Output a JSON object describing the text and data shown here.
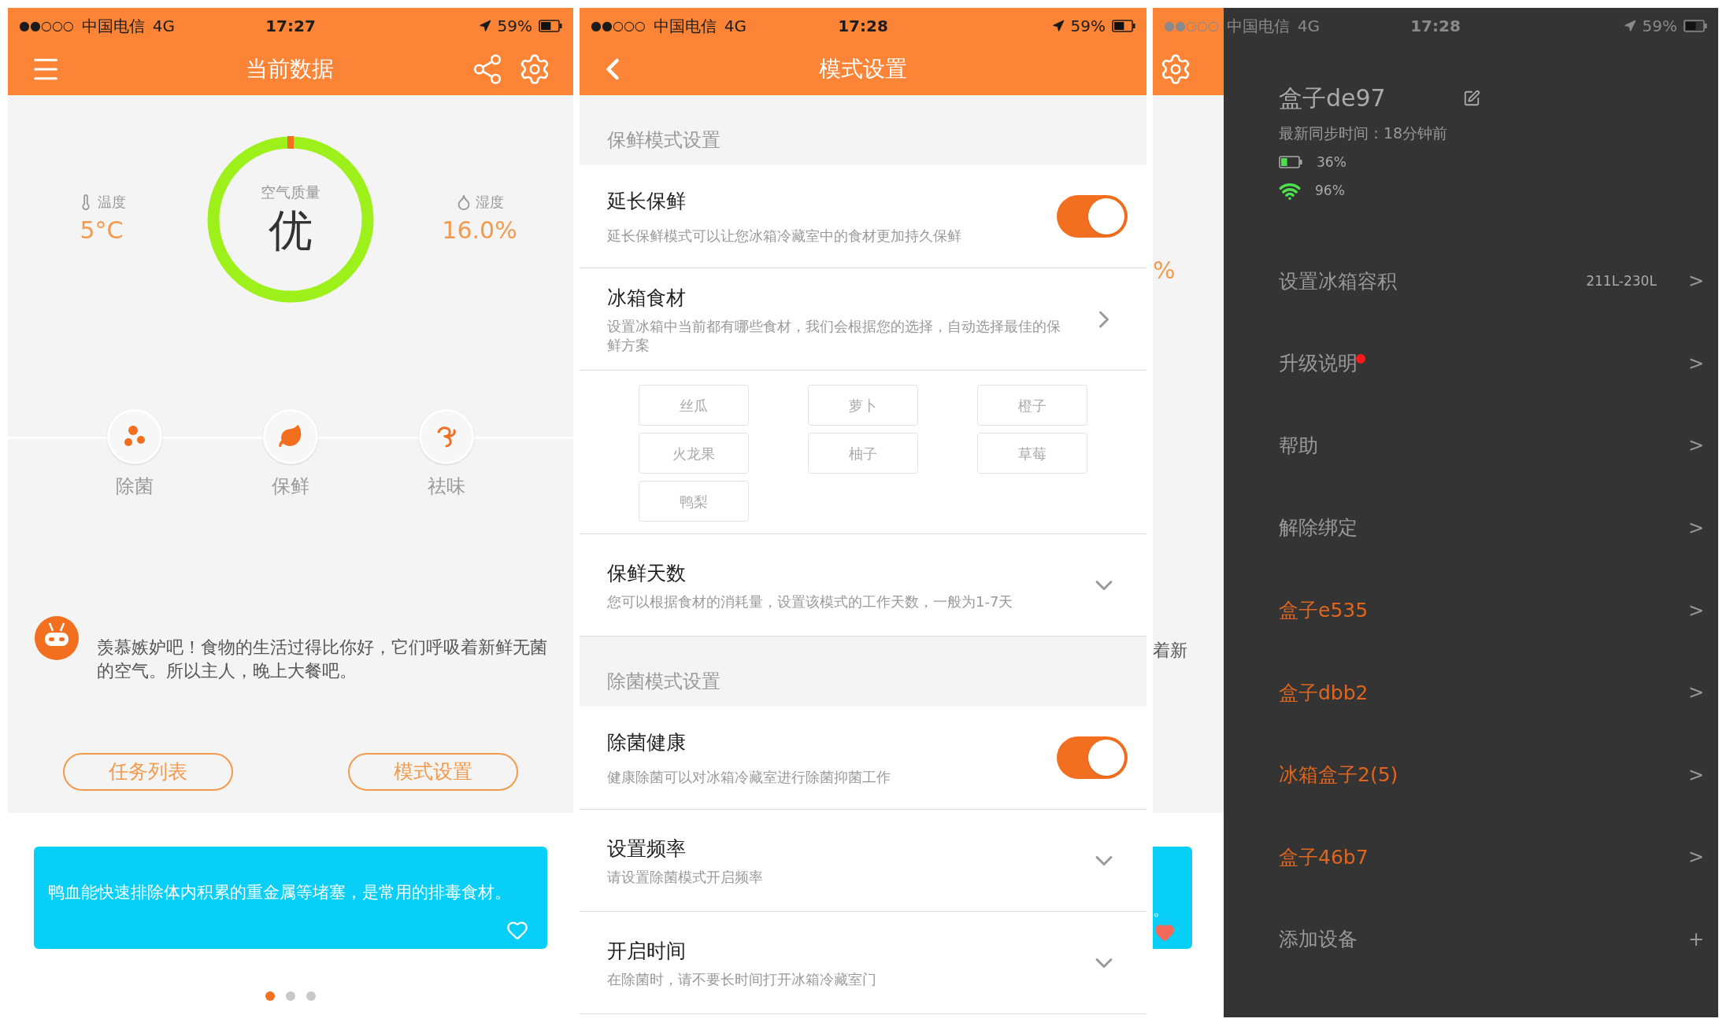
{
  "home_screen": {
    "status_bar": {
      "signal": "●●○○○",
      "carrier": "中国电信",
      "network": "4G",
      "time": "17:27",
      "battery": "59%"
    },
    "title": "当前数据",
    "temperature": {
      "label": "温度",
      "value": "5°C"
    },
    "air_quality": {
      "label": "空气质量",
      "value": "优"
    },
    "humidity": {
      "label": "湿度",
      "value": "16.0%"
    },
    "modes": [
      {
        "kind": "germ",
        "label": "除菌"
      },
      {
        "kind": "leaf",
        "label": "保鲜"
      },
      {
        "kind": "swirl",
        "label": "祛味"
      }
    ],
    "message": "羡慕嫉妒吧！食物的生活过得比你好，它们呼吸着新鲜无菌的空气。所以主人，晚上大餐吧。",
    "buttons": [
      "任务列表",
      "模式设置"
    ],
    "tip": "鸭血能快速排除体内积累的重金属等堵塞，是常用的排毒食材。",
    "page_dots": [
      {
        "selected": true
      },
      {
        "selected": false
      },
      {
        "selected": false
      }
    ]
  },
  "mode_settings_screen": {
    "status_bar": {
      "signal": "●●○○○",
      "carrier": "中国电信",
      "network": "4G",
      "time": "17:28",
      "battery": "59%"
    },
    "title": "模式设置",
    "sections": [
      {
        "header": "保鲜模式设置",
        "rows": [
          {
            "kind": "toggle",
            "title": "延长保鲜",
            "description": "延长保鲜模式可以让您冰箱冷藏室中的食材更加持久保鲜",
            "on": true
          },
          {
            "kind": "link",
            "title": "冰箱食材",
            "description": "设置冰箱中当前都有哪些食材，我们会根据您的选择，自动选择最佳的保鲜方案"
          },
          {
            "kind": "chips",
            "chips": [
              "丝瓜",
              "萝卜",
              "橙子",
              "火龙果",
              "柚子",
              "草莓",
              "鸭梨"
            ]
          },
          {
            "kind": "dropdown",
            "title": "保鲜天数",
            "description": "您可以根据食材的消耗量，设置该模式的工作天数，一般为1-7天"
          }
        ]
      },
      {
        "header": "除菌模式设置",
        "rows": [
          {
            "kind": "toggle",
            "title": "除菌健康",
            "description": "健康除菌可以对冰箱冷藏室进行除菌抑菌工作",
            "on": true
          },
          {
            "kind": "dropdown",
            "title": "设置频率",
            "description": "请设置除菌模式开启频率"
          },
          {
            "kind": "dropdown",
            "title": "开启时间",
            "description": "在除菌时，请不要长时间打开冰箱冷藏室门"
          }
        ]
      }
    ]
  },
  "drawer_screen": {
    "status_bar": {
      "signal": "●●○○○",
      "carrier": "中国电信",
      "network": "4G",
      "time": "17:28",
      "battery": "59%"
    },
    "background_fragments": [
      "%",
      "着新",
      "。"
    ],
    "drawer": {
      "device_name": "盒子de97",
      "sync": "最新同步时间：18分钟前",
      "battery": "36%",
      "wifi": "96%",
      "items": [
        {
          "kind": "setting",
          "label": "设置冰箱容积",
          "value": "211L-230L",
          "new": false,
          "trailing": ">"
        },
        {
          "kind": "setting",
          "label": "升级说明",
          "new": true,
          "trailing": ">"
        },
        {
          "kind": "setting",
          "label": "帮助",
          "new": false,
          "trailing": ">"
        },
        {
          "kind": "setting",
          "label": "解除绑定",
          "new": false,
          "trailing": ">"
        },
        {
          "kind": "device",
          "label": "盒子e535",
          "new": false,
          "trailing": ">"
        },
        {
          "kind": "device",
          "label": "盒子dbb2",
          "new": false,
          "trailing": ">"
        },
        {
          "kind": "device",
          "label": "冰箱盒子2(5)",
          "new": false,
          "trailing": ">"
        },
        {
          "kind": "device",
          "label": "盒子46b7",
          "new": false,
          "trailing": ">"
        },
        {
          "kind": "setting",
          "label": "添加设备",
          "new": false,
          "trailing": "+"
        }
      ]
    }
  }
}
